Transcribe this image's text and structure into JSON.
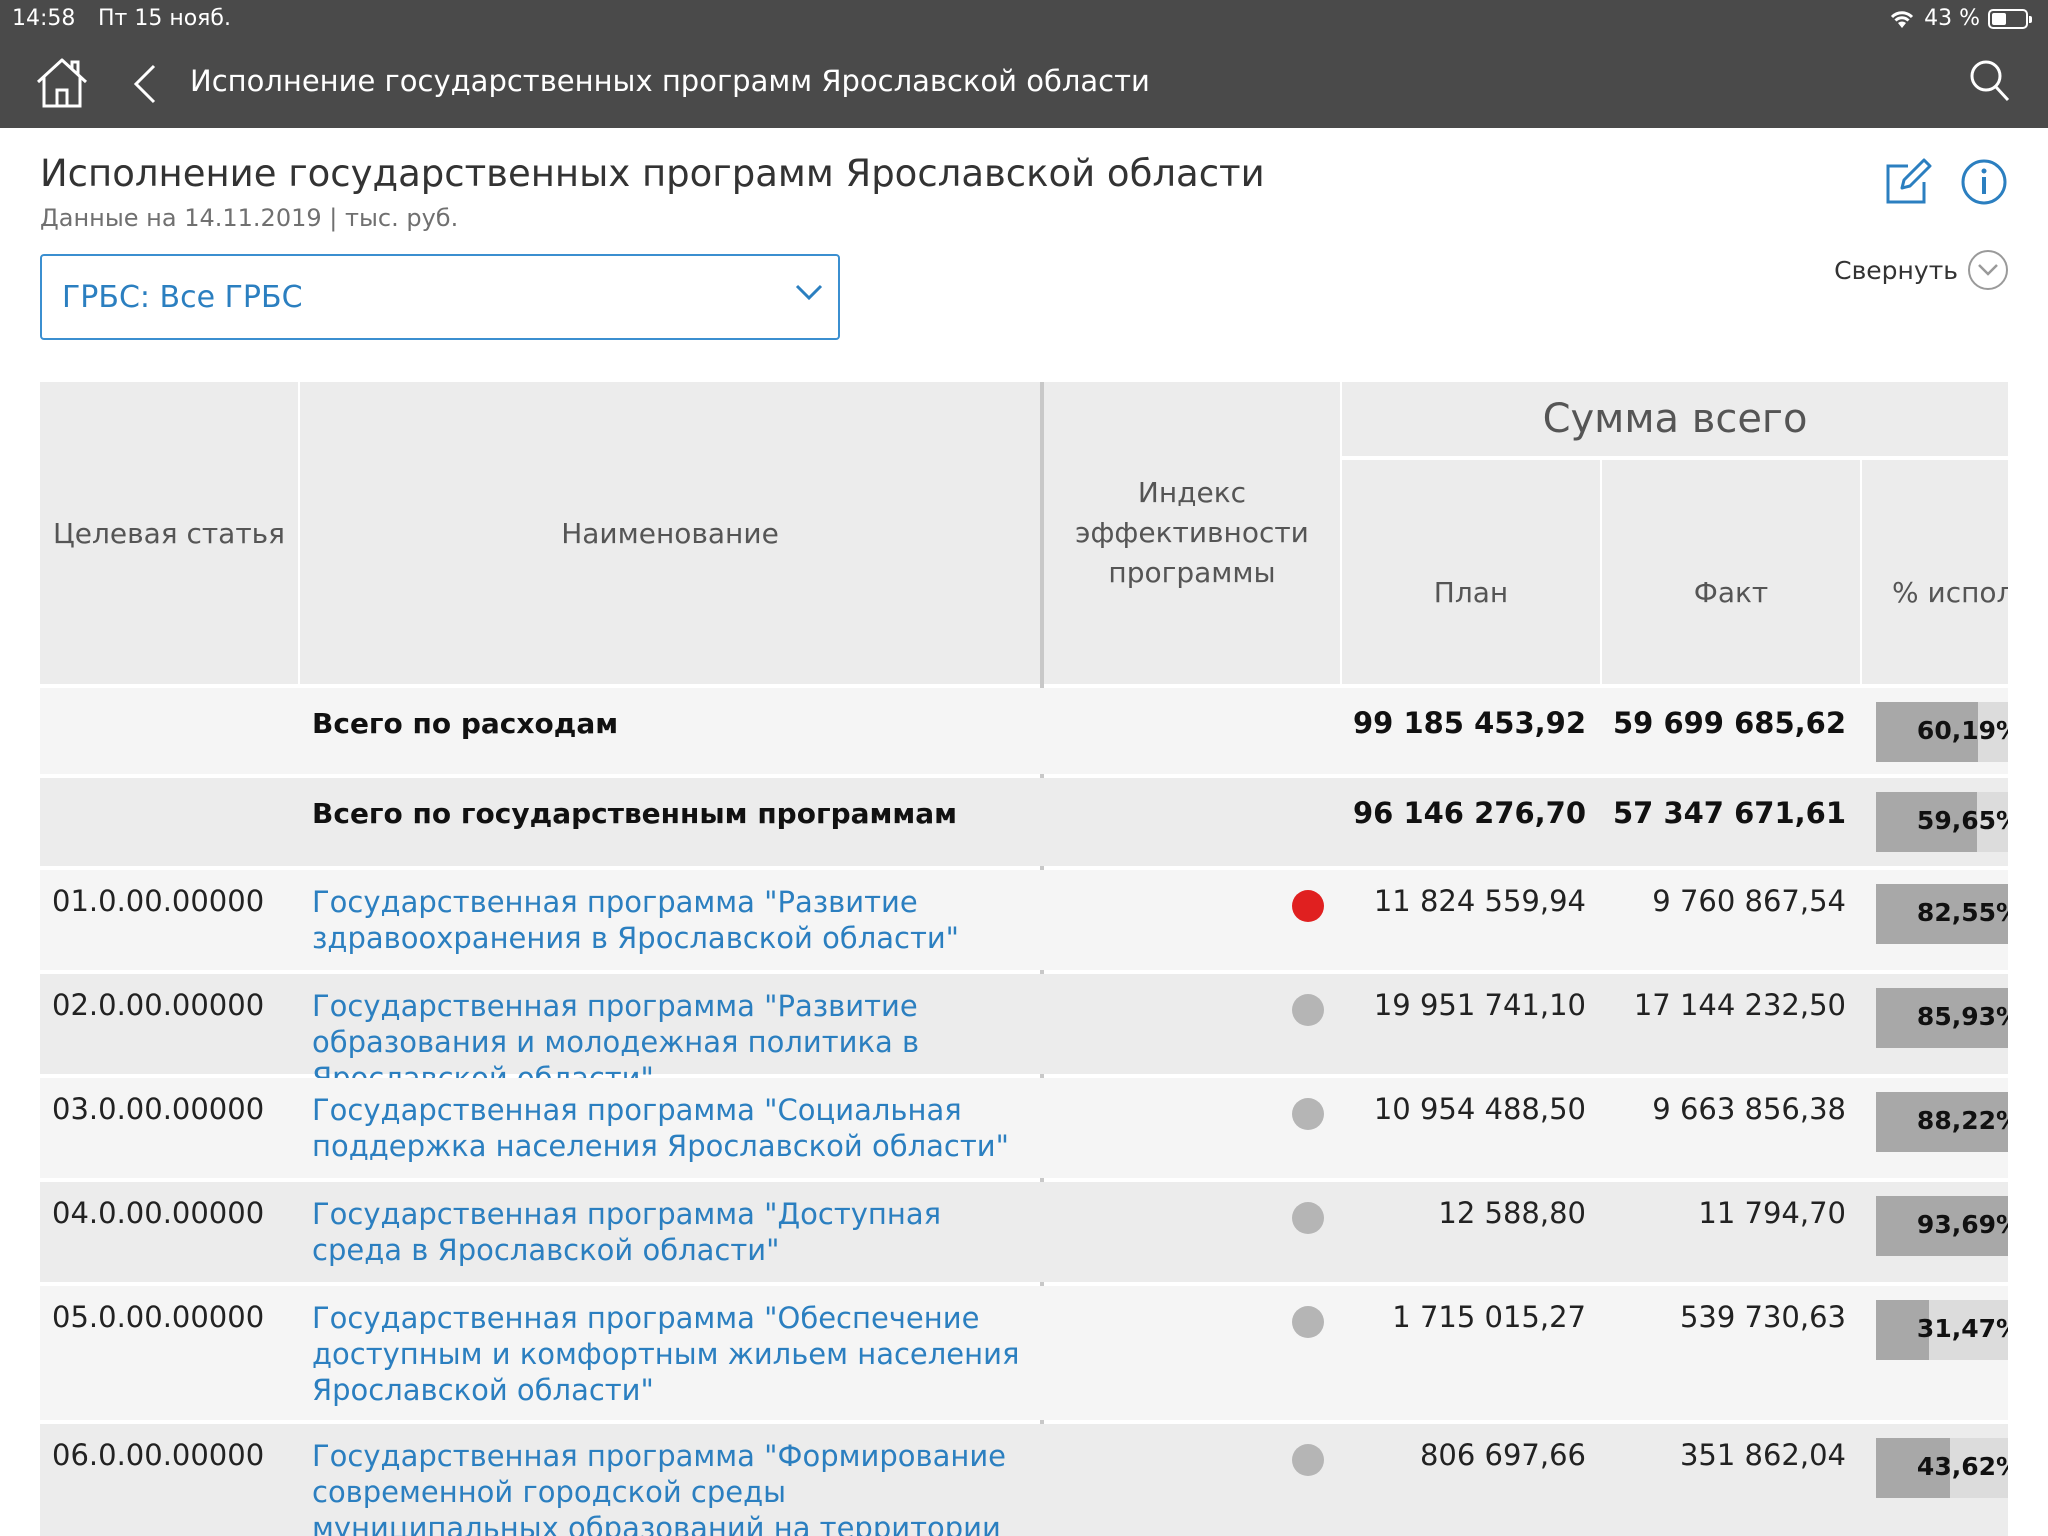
{
  "status_bar": {
    "time": "14:58",
    "date": "Пт 15 нояб.",
    "battery": "43 %",
    "battery_level": 0.43
  },
  "nav": {
    "title": "Исполнение государственных программ Ярославской области",
    "icons": [
      "home-icon",
      "back-icon",
      "search-icon"
    ]
  },
  "header": {
    "title": "Исполнение государственных программ Ярославской области",
    "subtitle": "Данные на 14.11.2019 | тыс. руб.",
    "collapse_label": "Свернуть",
    "filter_value": "ГРБС: Все ГРБС"
  },
  "colors": {
    "accent": "#2b7fc0",
    "nav_bg": "#4a4a4a",
    "status_red": "#e02020",
    "status_grey": "#b5b5b5"
  },
  "table": {
    "group_header": "Сумма всего",
    "columns": {
      "code": "Целевая статья",
      "name": "Наименование",
      "index": "Индекс эффективности программы",
      "plan": "План",
      "fact": "Факт",
      "pct": "% исполнения"
    },
    "rows": [
      {
        "code": "",
        "name": "Всего по расходам",
        "plan": "99 185 453,92",
        "fact": "59 699 685,62",
        "pct": "60,19%",
        "pct_value": 60.19,
        "bold": true,
        "indicator": ""
      },
      {
        "code": "",
        "name": "Всего по государственным программам",
        "plan": "96 146 276,70",
        "fact": "57 347 671,61",
        "pct": "59,65%",
        "pct_value": 59.65,
        "bold": true,
        "indicator": ""
      },
      {
        "code": "01.0.00.00000",
        "name": "Государственная программа \"Развитие здравоохранения в Ярославской области\"",
        "plan": "11 824 559,94",
        "fact": "9 760 867,54",
        "pct": "82,55%",
        "pct_value": 82.55,
        "bold": false,
        "indicator": "red"
      },
      {
        "code": "02.0.00.00000",
        "name": "Государственная программа \"Развитие образования и молодежная политика в Ярославской области\"",
        "plan": "19 951 741,10",
        "fact": "17 144 232,50",
        "pct": "85,93%",
        "pct_value": 85.93,
        "bold": false,
        "indicator": "grey"
      },
      {
        "code": "03.0.00.00000",
        "name": "Государственная программа \"Социальная поддержка населения Ярославской области\"",
        "plan": "10 954 488,50",
        "fact": "9 663 856,38",
        "pct": "88,22%",
        "pct_value": 88.22,
        "bold": false,
        "indicator": "grey"
      },
      {
        "code": "04.0.00.00000",
        "name": "Государственная программа \"Доступная среда в Ярославской области\"",
        "plan": "12 588,80",
        "fact": "11 794,70",
        "pct": "93,69%",
        "pct_value": 93.69,
        "bold": false,
        "indicator": "grey"
      },
      {
        "code": "05.0.00.00000",
        "name": "Государственная программа \"Обеспечение доступным и комфортным жильем населения Ярославской области\"",
        "plan": "1 715 015,27",
        "fact": "539 730,63",
        "pct": "31,47%",
        "pct_value": 31.47,
        "bold": false,
        "indicator": "grey"
      },
      {
        "code": "06.0.00.00000",
        "name": "Государственная программа \"Формирование современной городской среды муниципальных образований на территории Ярославской области\"",
        "plan": "806 697,66",
        "fact": "351 862,04",
        "pct": "43,62%",
        "pct_value": 43.62,
        "bold": false,
        "indicator": "grey"
      }
    ]
  }
}
